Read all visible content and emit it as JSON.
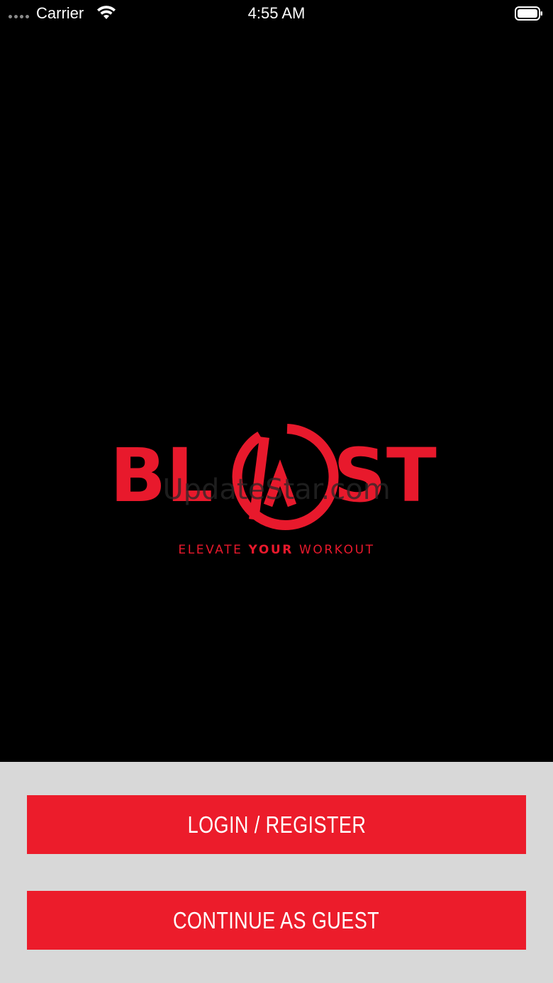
{
  "status_bar": {
    "carrier": "Carrier",
    "time": "4:55 AM",
    "icons": [
      "signal-dots-icon",
      "wifi-icon",
      "battery-icon"
    ]
  },
  "logo": {
    "letters_left": "BL",
    "letters_right": "ST",
    "tagline_part1": "ELEVATE ",
    "tagline_part2": "YOUR",
    "tagline_part3": " WORKOUT",
    "color": "#e8192c"
  },
  "watermark": "UpdateStar.com",
  "buttons": {
    "login_label": "LOGIN / REGISTER",
    "guest_label": "CONTINUE AS GUEST",
    "color": "#ec1c2b"
  },
  "colors": {
    "background": "#000000",
    "panel": "#d8d8d8"
  }
}
